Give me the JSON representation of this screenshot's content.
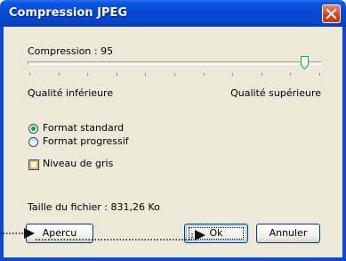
{
  "window": {
    "title": "Compression JPEG",
    "title_color": "#0a55e3",
    "close_icon": "close-icon"
  },
  "compression": {
    "label": "Compression : 95",
    "value": 95,
    "min_label": "Qualité inférieure",
    "max_label": "Qualité supérieure"
  },
  "format": {
    "options": [
      {
        "label": "Format standard",
        "selected": true
      },
      {
        "label": "Format progressif",
        "selected": false
      }
    ]
  },
  "grayscale": {
    "label": "Niveau de gris",
    "checked": false
  },
  "file_size": {
    "label": "Taille du fichier : 831,26 Ko"
  },
  "buttons": {
    "preview": "Apercu",
    "ok": "Ok",
    "cancel": "Annuler"
  },
  "colors": {
    "dialog_bg": "#ece9d8",
    "border_blue": "#0a4ad6",
    "radio_selected": "#21a121"
  }
}
